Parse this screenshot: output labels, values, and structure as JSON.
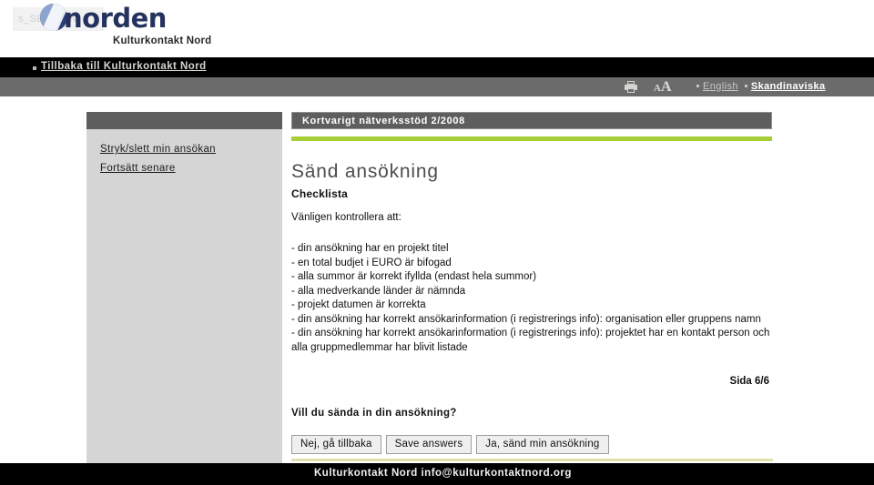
{
  "header": {
    "session_watermark": "s_SESSION",
    "logo_word": "norden",
    "logo_sub": "Kulturkontakt Nord"
  },
  "topnav": {
    "back_link": "Tillbaka till Kulturkontakt Nord"
  },
  "utilbar": {
    "print_icon": "printer-icon",
    "textsize_small": "A",
    "textsize_large": "A",
    "lang_english": "English",
    "lang_scandinavian": "Skandinaviska"
  },
  "sidebar": {
    "links": [
      {
        "label": "Stryk/slett min ansökan"
      },
      {
        "label": "Fortsätt senare"
      }
    ]
  },
  "main": {
    "breadcrumb": "Kortvarigt nätverksstöd 2/2008",
    "title": "Sänd ansökning",
    "section_heading": "Checklista",
    "intro": "Vänligen kontrollera att:",
    "checklist": [
      "- din ansökning har en projekt titel",
      "- en total budjet i EURO är bifogad",
      "- alla summor är korrekt ifyllda (endast hela summor)",
      "- alla medverkande länder är nämnda",
      "- projekt datumen är korrekta",
      "- din ansökning har korrekt ansökarinformation (i registrerings info): organisation eller gruppens namn",
      "- din ansökning har korrekt ansökarinformation (i registrerings info): projektet har en kontakt person och alla gruppmedlemmar har blivit listade"
    ],
    "page_count": "Sida 6/6",
    "confirm_question": "Vill du sända in din ansökning?",
    "buttons": [
      {
        "label": "Nej, gå tillbaka"
      },
      {
        "label": "Save answers"
      },
      {
        "label": "Ja, sänd min ansökning"
      }
    ]
  },
  "footer": {
    "text": "Kulturkontakt Nord  info@kulturkontaktnord.org"
  },
  "colors": {
    "accent_green": "#a6ce39",
    "bar_gray": "#5e5e5e",
    "util_gray": "#6b6b6b",
    "sidebar_gray": "#d5d5d5",
    "brand_navy": "#24325e",
    "footer_black": "#000000",
    "bottom_rule": "#e0e2ae"
  }
}
